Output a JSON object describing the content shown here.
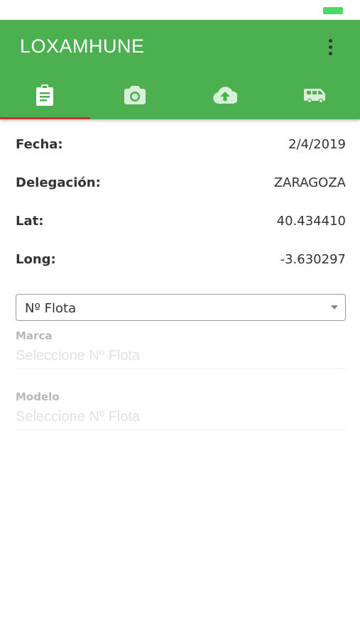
{
  "colors": {
    "primary": "#4caf50",
    "tab_indicator": "#d32f2f",
    "battery": "#4cd964",
    "tab_icon": "#d8efd9",
    "tab_icon_active": "#ffffff"
  },
  "app_bar": {
    "title": "LOXAMHUNE",
    "menu_icon": "more-vert-icon"
  },
  "tabs": [
    {
      "icon": "clipboard-icon",
      "active": true
    },
    {
      "icon": "camera-icon",
      "active": false
    },
    {
      "icon": "cloud-upload-icon",
      "active": false
    },
    {
      "icon": "van-icon",
      "active": false
    }
  ],
  "info": {
    "fecha": {
      "label": "Fecha:",
      "value": "2/4/2019"
    },
    "delegacion": {
      "label": "Delegación:",
      "value": "ZARAGOZA"
    },
    "lat": {
      "label": "Lat:",
      "value": "40.434410"
    },
    "long": {
      "label": "Long:",
      "value": "-3.630297"
    }
  },
  "flota_select": {
    "selected": "Nº Flota"
  },
  "marca": {
    "label": "Marca",
    "placeholder": "Seleccione Nº Flota"
  },
  "modelo": {
    "label": "Modelo",
    "placeholder": "Seleccione Nº Flota"
  }
}
